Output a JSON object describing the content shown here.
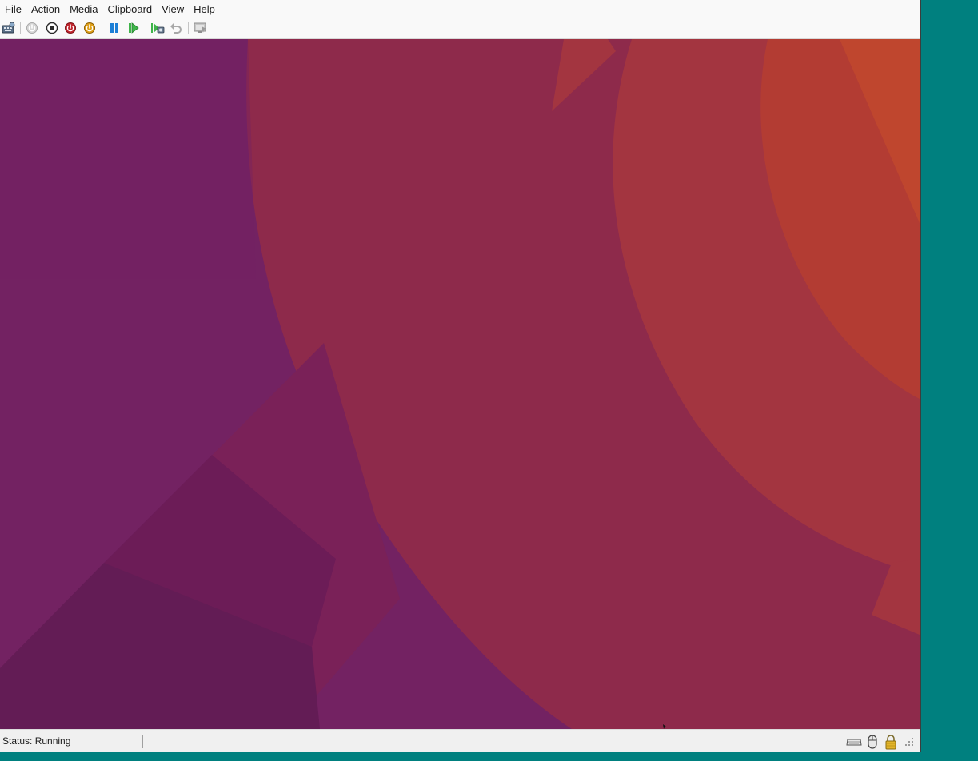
{
  "menu": {
    "items": [
      {
        "id": "file",
        "label": "File"
      },
      {
        "id": "action",
        "label": "Action"
      },
      {
        "id": "media",
        "label": "Media"
      },
      {
        "id": "clipboard",
        "label": "Clipboard"
      },
      {
        "id": "view",
        "label": "View"
      },
      {
        "id": "help",
        "label": "Help"
      }
    ]
  },
  "toolbar": {
    "buttons": [
      {
        "name": "ctrl-alt-del-icon",
        "enabled": true
      },
      {
        "name": "start-icon",
        "enabled": false
      },
      {
        "name": "turn-off-icon",
        "enabled": true
      },
      {
        "name": "shut-down-icon",
        "enabled": true
      },
      {
        "name": "save-icon",
        "enabled": true
      },
      {
        "name": "pause-icon",
        "enabled": true
      },
      {
        "name": "reset-icon",
        "enabled": true
      },
      {
        "name": "checkpoint-icon",
        "enabled": true
      },
      {
        "name": "revert-icon",
        "enabled": false
      },
      {
        "name": "enhanced-session-icon",
        "enabled": false
      }
    ]
  },
  "colors": {
    "desktop_bg": "#00807f",
    "wallpaper_purple": "#6d2260",
    "wallpaper_red": "#8e2a4b",
    "wallpaper_orange": "#b33c33",
    "accent_green": "#3fb44a",
    "accent_blue": "#1c7fd6",
    "stop_red": "#c0262e",
    "save_orange": "#d38e13"
  },
  "status": {
    "text": "Status: Running"
  },
  "status_icons": [
    {
      "name": "keyboard-icon"
    },
    {
      "name": "mouse-icon"
    },
    {
      "name": "lock-icon"
    },
    {
      "name": "resize-grip-icon"
    }
  ]
}
